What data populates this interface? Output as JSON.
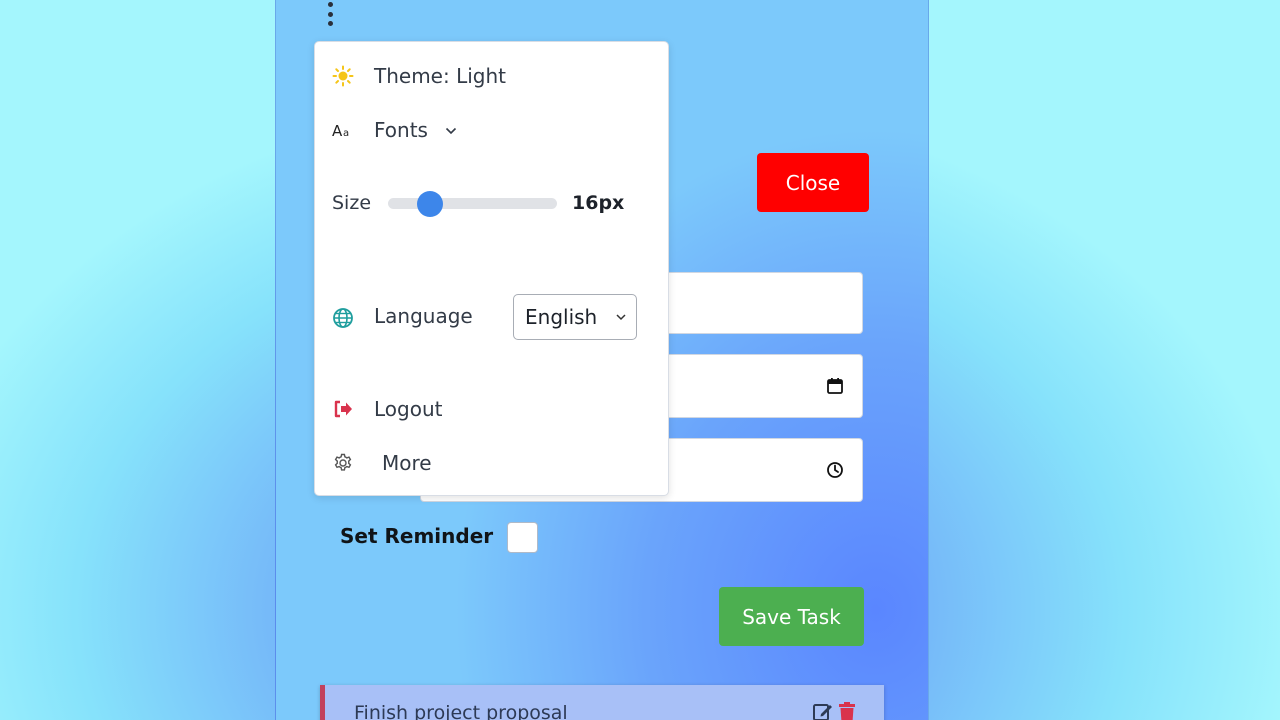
{
  "menu": {
    "theme_label": "Theme: Light",
    "fonts_label": "Fonts",
    "size_label": "Size",
    "size_value": "16px",
    "size_slider_fraction": 0.25,
    "language_label": "Language",
    "language_selected": "English",
    "logout_label": "Logout",
    "more_label": "More",
    "icons": {
      "theme": "sun-icon",
      "fonts": "font-size-icon",
      "fonts_toggle": "chevron-down-icon",
      "language": "globe-icon",
      "logout": "logout-icon",
      "more": "gear-icon"
    }
  },
  "header": {
    "menu_icon": "kebab-menu-icon"
  },
  "form": {
    "close_label": "Close",
    "date_icon": "calendar-icon",
    "time_icon": "clock-icon",
    "reminder_label": "Set Reminder",
    "reminder_checked": false,
    "save_label": "Save Task"
  },
  "tasks": [
    {
      "title": "Finish project proposal",
      "edit_icon": "edit-icon",
      "delete_icon": "trash-icon"
    }
  ],
  "colors": {
    "close_button": "#ff0000",
    "save_button": "#4caf50",
    "slider_thumb": "#3d86ea",
    "logout_icon": "#d9334d",
    "task_border": "#c2415d",
    "theme_icon": "#f5c518",
    "globe_icon": "#1f9e9e"
  }
}
